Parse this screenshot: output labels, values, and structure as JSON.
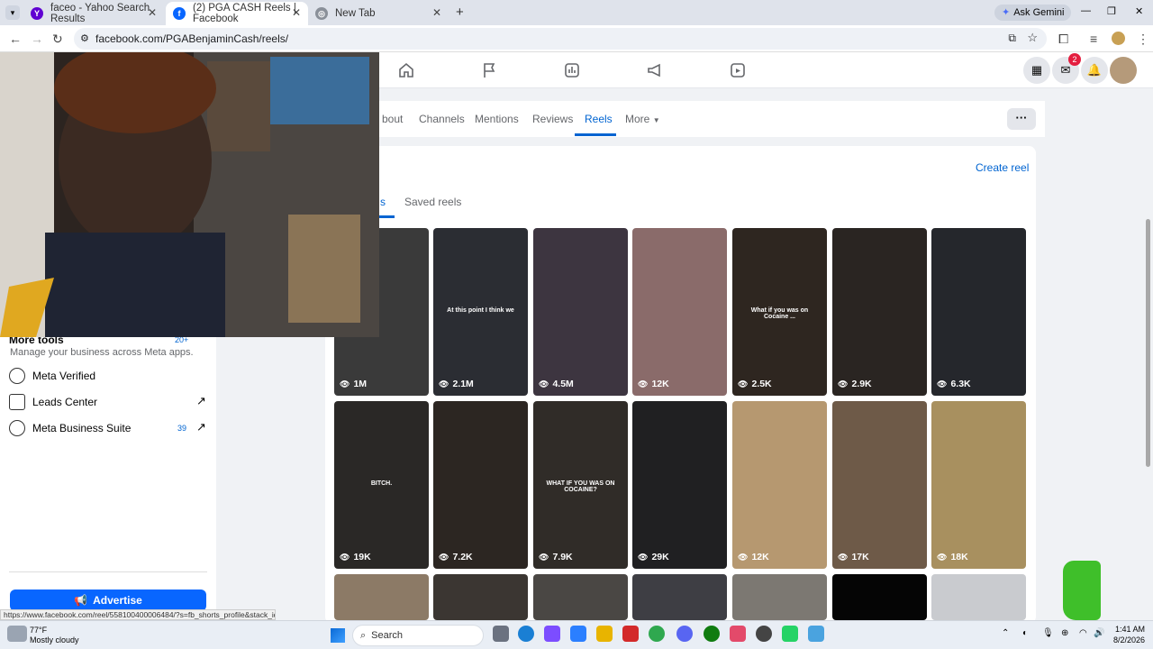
{
  "browser": {
    "tabs": [
      {
        "title": "faceo - Yahoo Search Results"
      },
      {
        "title": "(2) PGA CASH Reels | Facebook"
      },
      {
        "title": "New Tab"
      }
    ],
    "new_tab": "+",
    "gemini": "Ask Gemini",
    "url": "facebook.com/PGABenjaminCash/reels/",
    "status_url": "https://www.facebook.com/reel/558100400006484/?s=fb_shorts_profile&stack_idx=0"
  },
  "fb": {
    "messenger_badge": "2",
    "page_tabs": [
      "bout",
      "Channels",
      "Mentions",
      "Reviews",
      "Reels",
      "More"
    ],
    "active_tab": "Reels",
    "more_options": "···",
    "create_reel": "Create reel",
    "reels_tabs": [
      "s",
      "Saved reels"
    ],
    "sidebar": {
      "more_tools": "More tools",
      "more_tools_badge": "20+",
      "more_tools_desc": "Manage your business across Meta apps.",
      "items": [
        {
          "label": "Meta Verified",
          "badge": ""
        },
        {
          "label": "Leads Center",
          "badge": ""
        },
        {
          "label": "Meta Business Suite",
          "badge": "39"
        }
      ],
      "advertise": "Advertise"
    },
    "reels": [
      {
        "views": "1M",
        "caption": "",
        "bg": "#3a3a3a"
      },
      {
        "views": "2.1M",
        "caption": "At this point I think we",
        "bg": "#2b2d33"
      },
      {
        "views": "4.5M",
        "caption": "",
        "bg": "#3d3540"
      },
      {
        "views": "12K",
        "caption": "",
        "bg": "#8a6b6a"
      },
      {
        "views": "2.5K",
        "caption": "What if you was on Cocaine ...",
        "bg": "#2e2620"
      },
      {
        "views": "2.9K",
        "caption": "",
        "bg": "#2a2522"
      },
      {
        "views": "6.3K",
        "caption": "",
        "bg": "#25272c"
      },
      {
        "views": "19K",
        "caption": "BITCH.",
        "bg": "#2a2826"
      },
      {
        "views": "7.2K",
        "caption": "",
        "bg": "#2c2622"
      },
      {
        "views": "7.9K",
        "caption": "WHAT IF YOU WAS ON COCAINE?",
        "bg": "#302c28"
      },
      {
        "views": "29K",
        "caption": "",
        "bg": "#202022"
      },
      {
        "views": "12K",
        "caption": "",
        "bg": "#b69870"
      },
      {
        "views": "17K",
        "caption": "",
        "bg": "#6e5a48"
      },
      {
        "views": "18K",
        "caption": "",
        "bg": "#a8905f"
      },
      {
        "views": "",
        "caption": "",
        "bg": "#8c7a66"
      },
      {
        "views": "",
        "caption": "",
        "bg": "#3b3632"
      },
      {
        "views": "",
        "caption": "",
        "bg": "#4a4744"
      },
      {
        "views": "",
        "caption": "",
        "bg": "#3e3e44"
      },
      {
        "views": "",
        "caption": "",
        "bg": "#7c7872"
      },
      {
        "views": "",
        "caption": "",
        "bg": "#050505"
      },
      {
        "views": "",
        "caption": "",
        "bg": "#c9cbcf"
      }
    ]
  },
  "taskbar": {
    "weather_temp": "77°F",
    "weather_desc": "Mostly cloudy",
    "search": "Search",
    "time": "1:41 AM",
    "date": "8/2/2026"
  },
  "colors": {
    "fb_blue": "#0866ff",
    "tab_active": "#0064d1"
  }
}
